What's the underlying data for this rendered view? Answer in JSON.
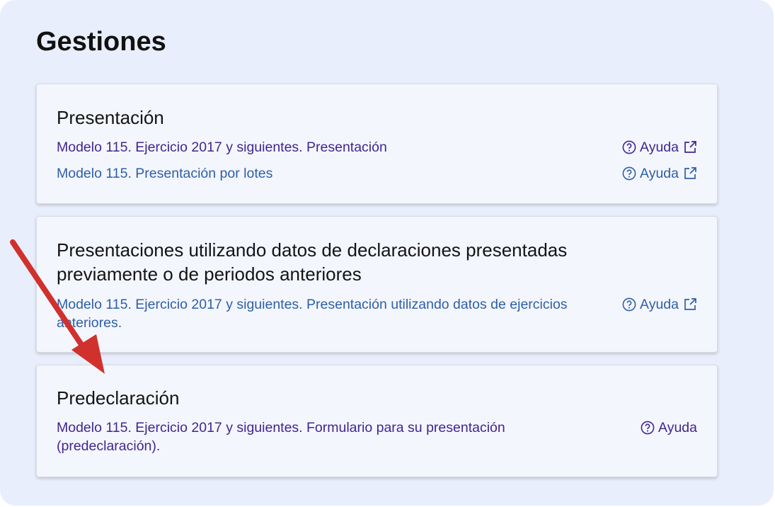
{
  "page": {
    "title": "Gestiones"
  },
  "sections": [
    {
      "title": "Presentación",
      "items": [
        {
          "label": "Modelo 115. Ejercicio 2017 y siguientes. Presentación",
          "help": "Ayuda",
          "external": true
        },
        {
          "label": "Modelo 115. Presentación por lotes",
          "help": "Ayuda",
          "external": true
        }
      ]
    },
    {
      "title": "Presentaciones utilizando datos de declaraciones presentadas previamente o de periodos anteriores",
      "items": [
        {
          "label": "Modelo 115. Ejercicio 2017 y siguientes. Presentación utilizando datos de ejercicios anteriores.",
          "help": "Ayuda",
          "external": true
        }
      ]
    },
    {
      "title": "Predeclaración",
      "items": [
        {
          "label": "Modelo 115. Ejercicio 2017 y siguientes. Formulario para su presentación (predeclaración).",
          "help": "Ayuda",
          "external": false
        }
      ]
    }
  ],
  "colors": {
    "panel_bg": "#e8eefb",
    "card_bg": "#f4f6fe",
    "link_visited": "#41268f",
    "link": "#2d5fa8",
    "arrow": "#d0312d"
  },
  "icons": {
    "help": "question-circle-icon",
    "external": "external-link-icon",
    "annotation": "red-arrow"
  }
}
